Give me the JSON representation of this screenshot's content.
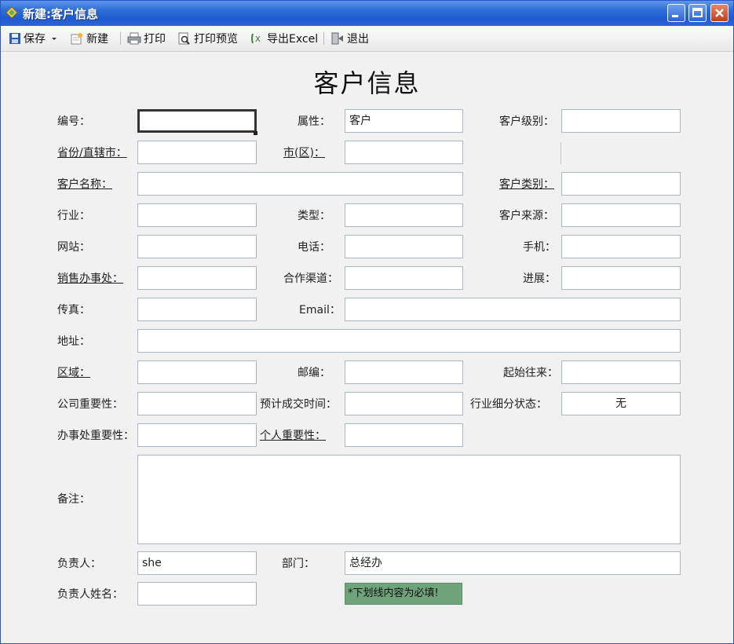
{
  "window": {
    "title": "新建:客户信息"
  },
  "toolbar": {
    "save": "保存",
    "new": "新建",
    "print": "打印",
    "print_preview": "打印预览",
    "export_excel": "导出Excel",
    "exit": "退出"
  },
  "form": {
    "title": "客户信息",
    "labels": {
      "id": "编号：",
      "attribute": "属性：",
      "customer_level": "客户级别：",
      "province": "省份/直辖市：",
      "city": "市(区)：",
      "customer_name": "客户名称：",
      "customer_category": "客户类别：",
      "industry": "行业：",
      "type": "类型：",
      "customer_source": "客户来源：",
      "website": "网站：",
      "phone": "电话：",
      "mobile": "手机：",
      "sales_office": "销售办事处：",
      "channel": "合作渠道：",
      "progress": "进展：",
      "fax": "传真：",
      "email": "Email：",
      "address": "地址：",
      "region": "区域：",
      "postcode": "邮编：",
      "first_contact": "起始往来：",
      "company_importance": "公司重要性：",
      "expected_deal_time": "预计成交时间：",
      "industry_segment_status": "行业细分状态：",
      "office_importance": "办事处重要性：",
      "personal_importance": "个人重要性：",
      "remarks": "备注：",
      "owner": "负责人：",
      "department": "部门：",
      "owner_name": "负责人姓名："
    },
    "values": {
      "id": "",
      "attribute": "客户",
      "customer_level": "",
      "province": "",
      "city": "",
      "customer_name": "",
      "customer_category": "",
      "industry": "",
      "type": "",
      "customer_source": "",
      "website": "",
      "phone": "",
      "mobile": "",
      "sales_office": "",
      "channel": "",
      "progress": "",
      "fax": "",
      "email": "",
      "address": "",
      "region": "",
      "postcode": "",
      "first_contact": "",
      "company_importance": "",
      "expected_deal_time": "",
      "industry_segment_status": "无",
      "office_importance": "",
      "personal_importance": "",
      "remarks": "",
      "owner": "she",
      "department": "总经办",
      "owner_name": ""
    },
    "note": "*下划线内容为必填!"
  },
  "colors": {
    "titlebar": "#2a66d6",
    "note_bg": "#6fa37a",
    "field_border": "#aeb8c4"
  }
}
